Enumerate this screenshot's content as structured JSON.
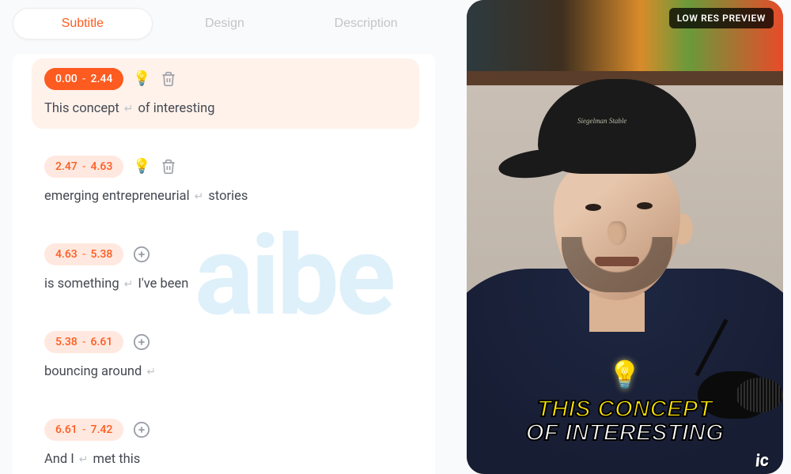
{
  "tabs": {
    "subtitle": "Subtitle",
    "design": "Design",
    "description": "Description"
  },
  "watermark": "aibe",
  "segments": [
    {
      "start": "0.00",
      "end": "2.44",
      "part_a": "This concept",
      "part_b": "of interesting",
      "selected": true,
      "has_bulb": true,
      "has_trash": true
    },
    {
      "start": "2.47",
      "end": "4.63",
      "part_a": "emerging entrepreneurial",
      "part_b": "stories",
      "selected": false,
      "has_bulb": true,
      "has_trash": true
    },
    {
      "start": "4.63",
      "end": "5.38",
      "part_a": "is something",
      "part_b": "I've been",
      "selected": false,
      "has_bulb": false,
      "has_trash": false
    },
    {
      "start": "5.38",
      "end": "6.61",
      "part_a": "bouncing around",
      "part_b": "",
      "selected": false,
      "has_bulb": false,
      "has_trash": false
    },
    {
      "start": "6.61",
      "end": "7.42",
      "part_a": "And I",
      "part_b": "met this",
      "selected": false,
      "has_bulb": false,
      "has_trash": false
    }
  ],
  "preview": {
    "badge": "LOW RES PREVIEW",
    "cap_text": "Siegelman Stable",
    "caption_line1": "THIS CONCEPT",
    "caption_line2": "OF INTERESTING",
    "corner": "ic"
  },
  "time_sep": "-"
}
